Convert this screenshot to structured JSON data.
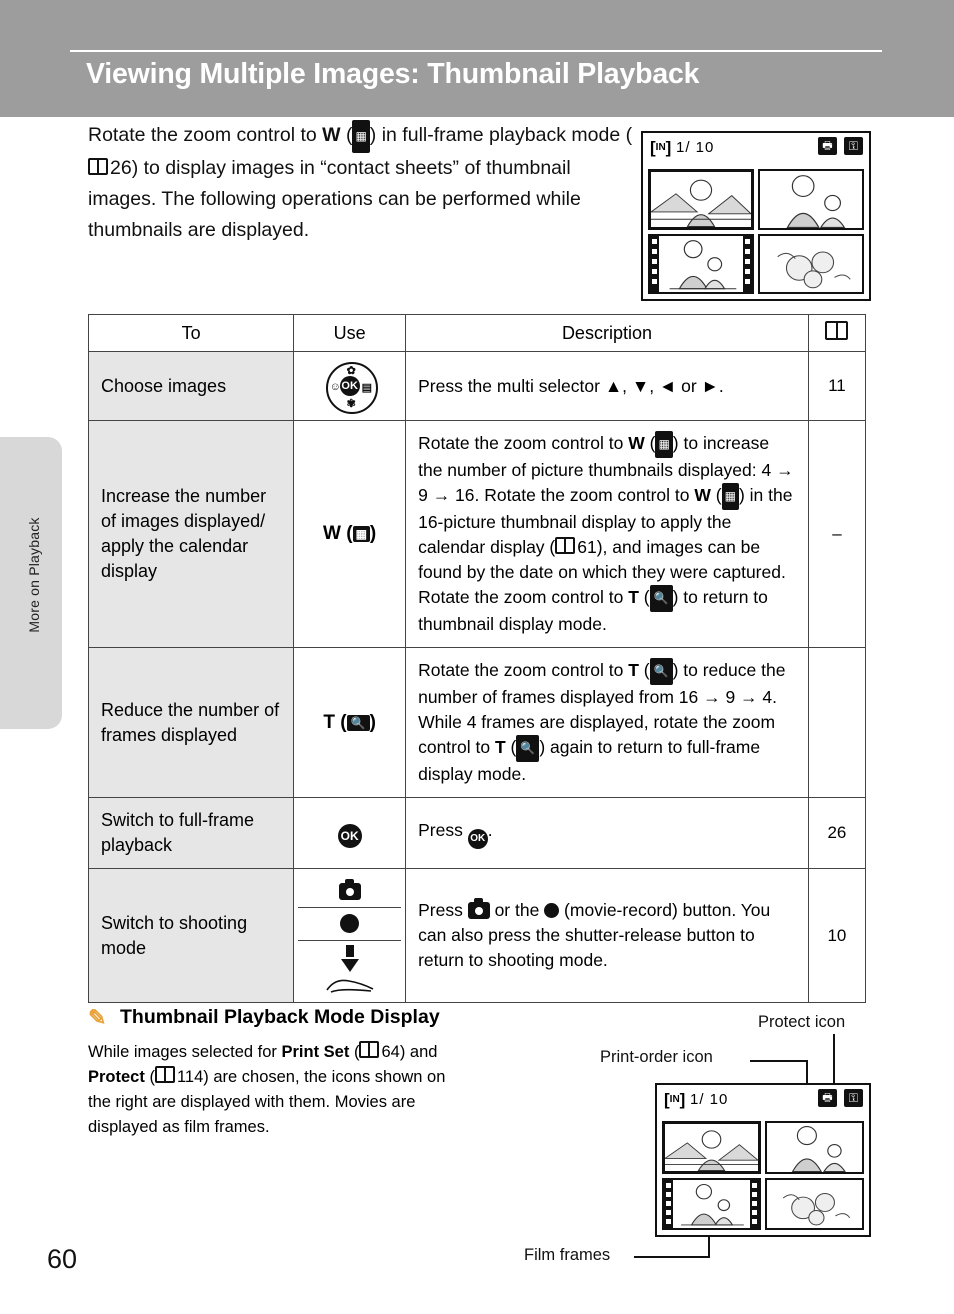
{
  "header": {
    "title": "Viewing Multiple Images: Thumbnail Playback"
  },
  "sidebar": {
    "tab_label": "More on Playback"
  },
  "intro": {
    "line1_a": "Rotate the zoom control to ",
    "line1_w": "W",
    "line1_b": " (",
    "line1_icon": "thumbnail-icon",
    "line1_c": ") in full-frame",
    "line2_a": "playback mode (",
    "line2_ref": "26",
    "line2_b": ") to display images in “contact",
    "line3": "sheets” of thumbnail images. The following operations",
    "line4": "can be performed while thumbnails are displayed."
  },
  "camera_top": {
    "in_label": "IN",
    "counter": "1/  10",
    "print_icon": "print-order-icon",
    "protect_icon": "protect-icon"
  },
  "table": {
    "headers": [
      "To",
      "Use",
      "Description",
      "book-icon"
    ],
    "rows": [
      {
        "to": "Choose images",
        "use_kind": "multi-selector",
        "use_label": "",
        "desc": "Press the multi selector ▲, ▼, ◄ or ►.",
        "ref": "11"
      },
      {
        "to": "Increase the number of images displayed/ apply the calendar display",
        "use_kind": "zoom-w",
        "use_label": "W",
        "desc_segments": [
          "Rotate the zoom control to ",
          "W",
          " (",
          "thumbnail-icon",
          ") to increase the number of picture thumbnails displayed: 4 → 9 → 16. Rotate the zoom control to ",
          "W",
          " (",
          "thumbnail-icon",
          ") in the 16-picture thumbnail display to apply the calendar display (",
          "61",
          "), and images can be found by the date on which they were captured.",
          "Rotate the zoom control to ",
          "T",
          " (",
          "magnify-icon",
          ") to return to thumbnail display mode."
        ],
        "ref": "–"
      },
      {
        "to": "Reduce the number of frames displayed",
        "use_kind": "zoom-t",
        "use_label": "T",
        "desc_segments": [
          "Rotate the zoom control to ",
          "T",
          " (",
          "magnify-icon",
          ") to reduce the number of frames displayed from 16 → 9 → 4. While 4 frames are displayed, rotate the zoom control to ",
          "T",
          " (",
          "magnify-icon",
          ") again to return to full-frame display mode."
        ],
        "ref": ""
      },
      {
        "to": "Switch to full-frame playback",
        "use_kind": "ok-button",
        "use_label": "OK",
        "desc": "Press k.",
        "ref": "26"
      },
      {
        "to": "Switch to shooting mode",
        "use_kind": "shooting-buttons",
        "use_label": "",
        "desc": "Press A or the b (movie-record) button. You can also press the shutter-release button to return to shooting mode.",
        "ref": "10"
      }
    ]
  },
  "note": {
    "icon": "pencil-icon",
    "title": "Thumbnail Playback Mode Display",
    "body_1": "While images selected for ",
    "body_print_set": "Print Set",
    "body_2": " (",
    "body_ref1": "64",
    "body_3": ") and",
    "body_protect": "Protect",
    "body_4": " (",
    "body_ref2": "114",
    "body_5": ") are chosen, the icons shown on",
    "body_6": "the right are displayed with them. Movies are",
    "body_7": "displayed as film frames."
  },
  "callouts": {
    "protect": "Protect icon",
    "print_order": "Print-order icon",
    "film_frames": "Film frames"
  },
  "camera_bottom": {
    "in_label": "IN",
    "counter": "1/  10"
  },
  "footer": {
    "page_number": "60"
  },
  "colors": {
    "header_band": "#9d9d9d",
    "side_tab": "#d8d8d8",
    "row_label_bg": "#e6e6e6",
    "pencil": "#e8a33d"
  }
}
